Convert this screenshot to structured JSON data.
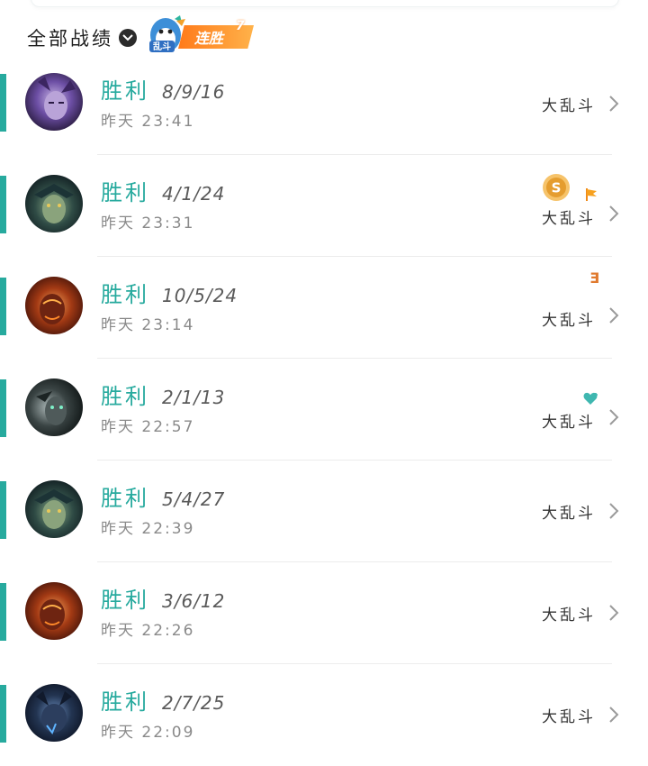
{
  "filter": {
    "label": "全部战绩"
  },
  "streak": {
    "mascot_text": "乱斗",
    "label": "连胜",
    "count": "7"
  },
  "colors": {
    "accent": "#27aa9e",
    "orange": "#ff8c2a"
  },
  "matches": [
    {
      "result": "胜利",
      "kda": "8/9/16",
      "time": "昨天 23:41",
      "mode": "大乱斗",
      "badge": ""
    },
    {
      "result": "胜利",
      "kda": "4/1/24",
      "time": "昨天 23:31",
      "mode": "大乱斗",
      "badge": "coin-flag",
      "badge_text": "S"
    },
    {
      "result": "胜利",
      "kda": "10/5/24",
      "time": "昨天 23:14",
      "mode": "大乱斗",
      "badge": "triple",
      "badge_text": "Ǝ"
    },
    {
      "result": "胜利",
      "kda": "2/1/13",
      "time": "昨天 22:57",
      "mode": "大乱斗",
      "badge": "heart"
    },
    {
      "result": "胜利",
      "kda": "5/4/27",
      "time": "昨天 22:39",
      "mode": "大乱斗",
      "badge": ""
    },
    {
      "result": "胜利",
      "kda": "3/6/12",
      "time": "昨天 22:26",
      "mode": "大乱斗",
      "badge": ""
    },
    {
      "result": "胜利",
      "kda": "2/7/25",
      "time": "昨天 22:09",
      "mode": "大乱斗",
      "badge": ""
    }
  ]
}
